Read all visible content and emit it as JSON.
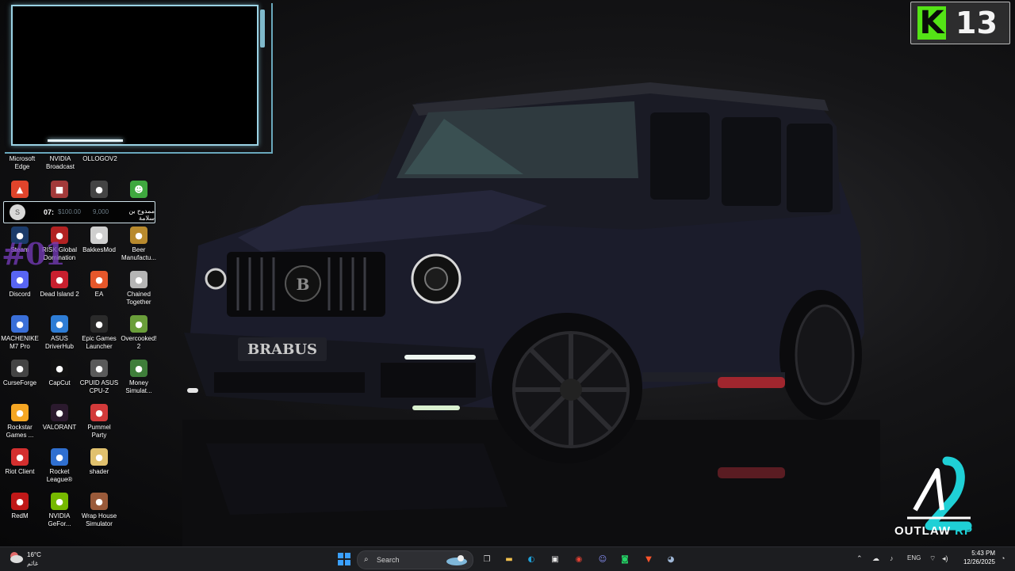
{
  "desktop": {
    "top_labels": [
      {
        "label": "Microsoft\nEdge"
      },
      {
        "label": "NVIDIA\nBroadcast"
      },
      {
        "label": "OLLOGOV2"
      }
    ],
    "icons": [
      {
        "label": "Steam",
        "icon": "steam-icon",
        "color": "#1b3b6a"
      },
      {
        "label": "RISK Global\nDomination",
        "icon": "risk-icon",
        "color": "#b22222"
      },
      {
        "label": "BakkesMod",
        "icon": "bakkesmod-icon",
        "color": "#cfcfcf"
      },
      {
        "label": "Beer\nManufactu...",
        "icon": "beer-icon",
        "color": "#b88a2e"
      },
      {
        "label": "Discord",
        "icon": "discord-icon",
        "color": "#5865f2"
      },
      {
        "label": "Dead Island 2",
        "icon": "dead-island-icon",
        "color": "#c8202f"
      },
      {
        "label": "EA",
        "icon": "ea-icon",
        "color": "#e5572b"
      },
      {
        "label": "Chained\nTogether",
        "icon": "chained-icon",
        "color": "#b5b5b5"
      },
      {
        "label": "MACHENIKE\nM7 Pro",
        "icon": "machenike-icon",
        "color": "#3a6fd8"
      },
      {
        "label": "ASUS\nDriverHub",
        "icon": "asus-icon",
        "color": "#2e7dd6"
      },
      {
        "label": "Epic Games\nLauncher",
        "icon": "epic-icon",
        "color": "#2a2a2a"
      },
      {
        "label": "Overcooked!\n2",
        "icon": "overcooked-icon",
        "color": "#6a9e3a"
      },
      {
        "label": "CurseForge",
        "icon": "curseforge-icon",
        "color": "#444444"
      },
      {
        "label": "CapCut",
        "icon": "capcut-icon",
        "color": "#111111"
      },
      {
        "label": "CPUID ASUS\nCPU-Z",
        "icon": "cpuz-icon",
        "color": "#5a5a5a"
      },
      {
        "label": "Money\nSimulat...",
        "icon": "money-sim-icon",
        "color": "#3f7e3a"
      },
      {
        "label": "Rockstar\nGames ...",
        "icon": "rockstar-icon",
        "color": "#f5a623"
      },
      {
        "label": "VALORANT",
        "icon": "valorant-icon",
        "color": "#2b1a2e"
      },
      {
        "label": "Pummel\nParty",
        "icon": "pummel-icon",
        "color": "#d23a3a"
      },
      {
        "label": "",
        "icon": "blank-icon",
        "color": "#000000"
      },
      {
        "label": "Riot Client",
        "icon": "riot-icon",
        "color": "#d32f2f"
      },
      {
        "label": "Rocket\nLeague®",
        "icon": "rocket-league-icon",
        "color": "#2f6fd0"
      },
      {
        "label": "shader",
        "icon": "folder-icon",
        "color": "#e1c16e"
      },
      {
        "label": "",
        "icon": "blank-icon",
        "color": "#000000"
      },
      {
        "label": "RedM",
        "icon": "redm-icon",
        "color": "#c01818"
      },
      {
        "label": "NVIDIA\nGeFor...",
        "icon": "nvidia-icon",
        "color": "#76b900"
      },
      {
        "label": "Wrap House\nSimulator",
        "icon": "wrap-house-icon",
        "color": "#9a5a3a"
      },
      {
        "label": "",
        "icon": "blank-icon",
        "color": "#000000"
      }
    ],
    "row2_icons": [
      {
        "icon": "brave-icon",
        "color": "#e0442b"
      },
      {
        "icon": "game-icon",
        "color": "#a23a3a"
      },
      {
        "icon": "app-icon",
        "color": "#444444"
      },
      {
        "icon": "alien-icon",
        "color": "#3fa83f"
      }
    ]
  },
  "status_bar": {
    "avatar": "S",
    "time": "07:",
    "cash": "$100.00",
    "bank": "9,000",
    "name": "ممدوح بن سلامة",
    "id_watermark": "#01"
  },
  "k13": {
    "letter": "K",
    "number": "13",
    "accent": "#54e316"
  },
  "outlaw": {
    "name": "OUTLAW",
    "suffix": "RP",
    "accent": "#1fd0d6"
  },
  "car": {
    "badge": "BRABUS"
  },
  "taskbar": {
    "weather_temp": "16°C",
    "weather_desc": "غائم",
    "search_placeholder": "Search",
    "apps": [
      {
        "name": "start-button",
        "icon": "windows-icon",
        "color": "#3aa0ff"
      },
      {
        "name": "task-view",
        "icon": "task-view-icon",
        "color": "#cfcfcf"
      },
      {
        "name": "file-explorer",
        "icon": "folder-icon",
        "color": "#f2c14e"
      },
      {
        "name": "edge",
        "icon": "edge-icon",
        "color": "#1fa0d8"
      },
      {
        "name": "store",
        "icon": "store-icon",
        "color": "#e8e8e8"
      },
      {
        "name": "chrome",
        "icon": "chrome-icon",
        "color": "#e34133"
      },
      {
        "name": "discord",
        "icon": "discord-icon",
        "color": "#5865f2"
      },
      {
        "name": "whatsapp",
        "icon": "whatsapp-icon",
        "color": "#25d366"
      },
      {
        "name": "brave",
        "icon": "brave-icon",
        "color": "#fb542b"
      },
      {
        "name": "steam",
        "icon": "steam-icon",
        "color": "#1b3b6a"
      }
    ],
    "language": "ENG",
    "time": "5:43 PM",
    "date": "12/26/2025"
  }
}
